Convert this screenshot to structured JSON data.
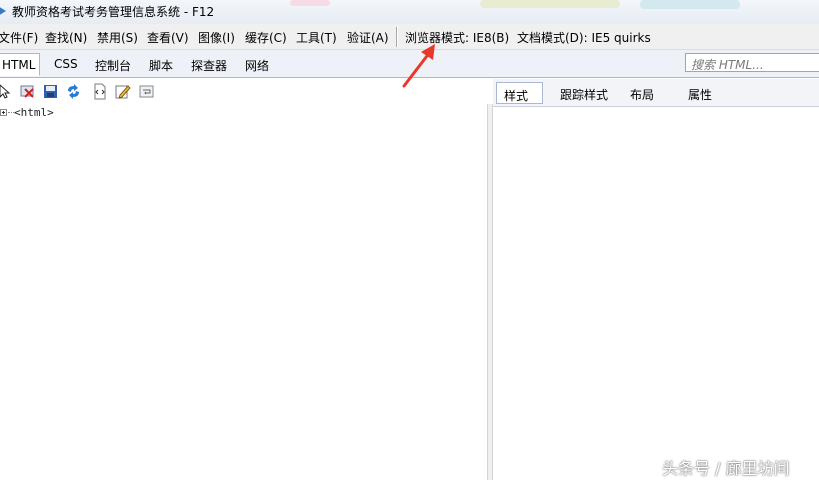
{
  "window": {
    "title": "教师资格考试考务管理信息系统 - F12"
  },
  "menu": {
    "items": [
      "文件(F)",
      "查找(N)",
      "禁用(S)",
      "查看(V)",
      "图像(I)",
      "缓存(C)",
      "工具(T)",
      "验证(A)"
    ],
    "browser_mode": "浏览器模式: IE8(B)",
    "document_mode": "文档模式(D): IE5 quirks"
  },
  "tabs": [
    "HTML",
    "CSS",
    "控制台",
    "脚本",
    "探查器",
    "网络"
  ],
  "search": {
    "placeholder": "搜索 HTML..."
  },
  "tree": {
    "root_tag": "<html>"
  },
  "right_tabs": [
    "样式",
    "跟踪样式",
    "布局",
    "属性"
  ],
  "watermark": "头条号 / 廊里坊间",
  "colors": {
    "arrow": "#e8382a",
    "tab_border": "#a9b8cc"
  }
}
